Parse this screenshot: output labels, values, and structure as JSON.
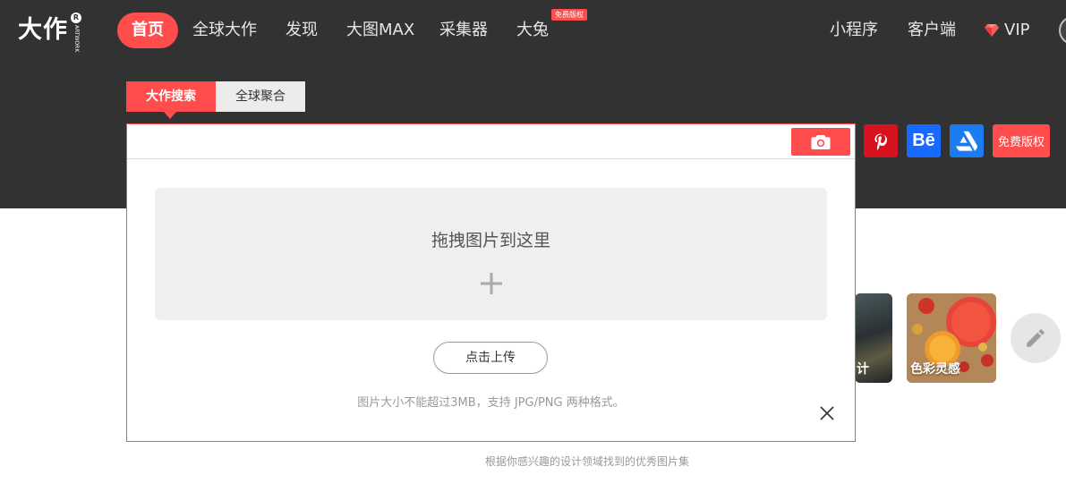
{
  "logo": {
    "text": "大作",
    "badge": "R",
    "side_text": "ARTWORK"
  },
  "nav": {
    "items": [
      {
        "label": "首页",
        "active": true
      },
      {
        "label": "全球大作"
      },
      {
        "label": "发现"
      },
      {
        "label": "大图MAX"
      },
      {
        "label": "采集器"
      },
      {
        "label": "大兔",
        "badge": "免费版权"
      }
    ],
    "right_items": [
      {
        "label": "小程序"
      },
      {
        "label": "客户端"
      },
      {
        "label": "VIP",
        "icon": "diamond-icon"
      }
    ]
  },
  "search": {
    "tabs": [
      {
        "label": "大作搜索",
        "active": true
      },
      {
        "label": "全球聚合"
      }
    ],
    "input_value": "",
    "camera_icon": "camera-icon"
  },
  "upload_panel": {
    "drop_text": "拖拽图片到这里",
    "button_label": "点击上传",
    "hint": "图片大小不能超过3MB，支持 JPG/PNG 两种格式。"
  },
  "sources": [
    {
      "name": "pinterest-icon",
      "color": "#d6121f"
    },
    {
      "name": "behance-icon",
      "label": "Bē",
      "color": "#1769ff"
    },
    {
      "name": "artstation-icon",
      "color": "#1d7bf0"
    },
    {
      "name": "free-copyright",
      "label": "免费版权",
      "color": "#ff4d4d"
    }
  ],
  "cards": [
    {
      "label": "计"
    },
    {
      "label": "色彩灵感"
    }
  ],
  "section": {
    "subtitle": "根据你感兴趣的设计领域找到的优秀图片集"
  },
  "colors": {
    "accent": "#ff4d4d",
    "header_bg": "#323232"
  }
}
